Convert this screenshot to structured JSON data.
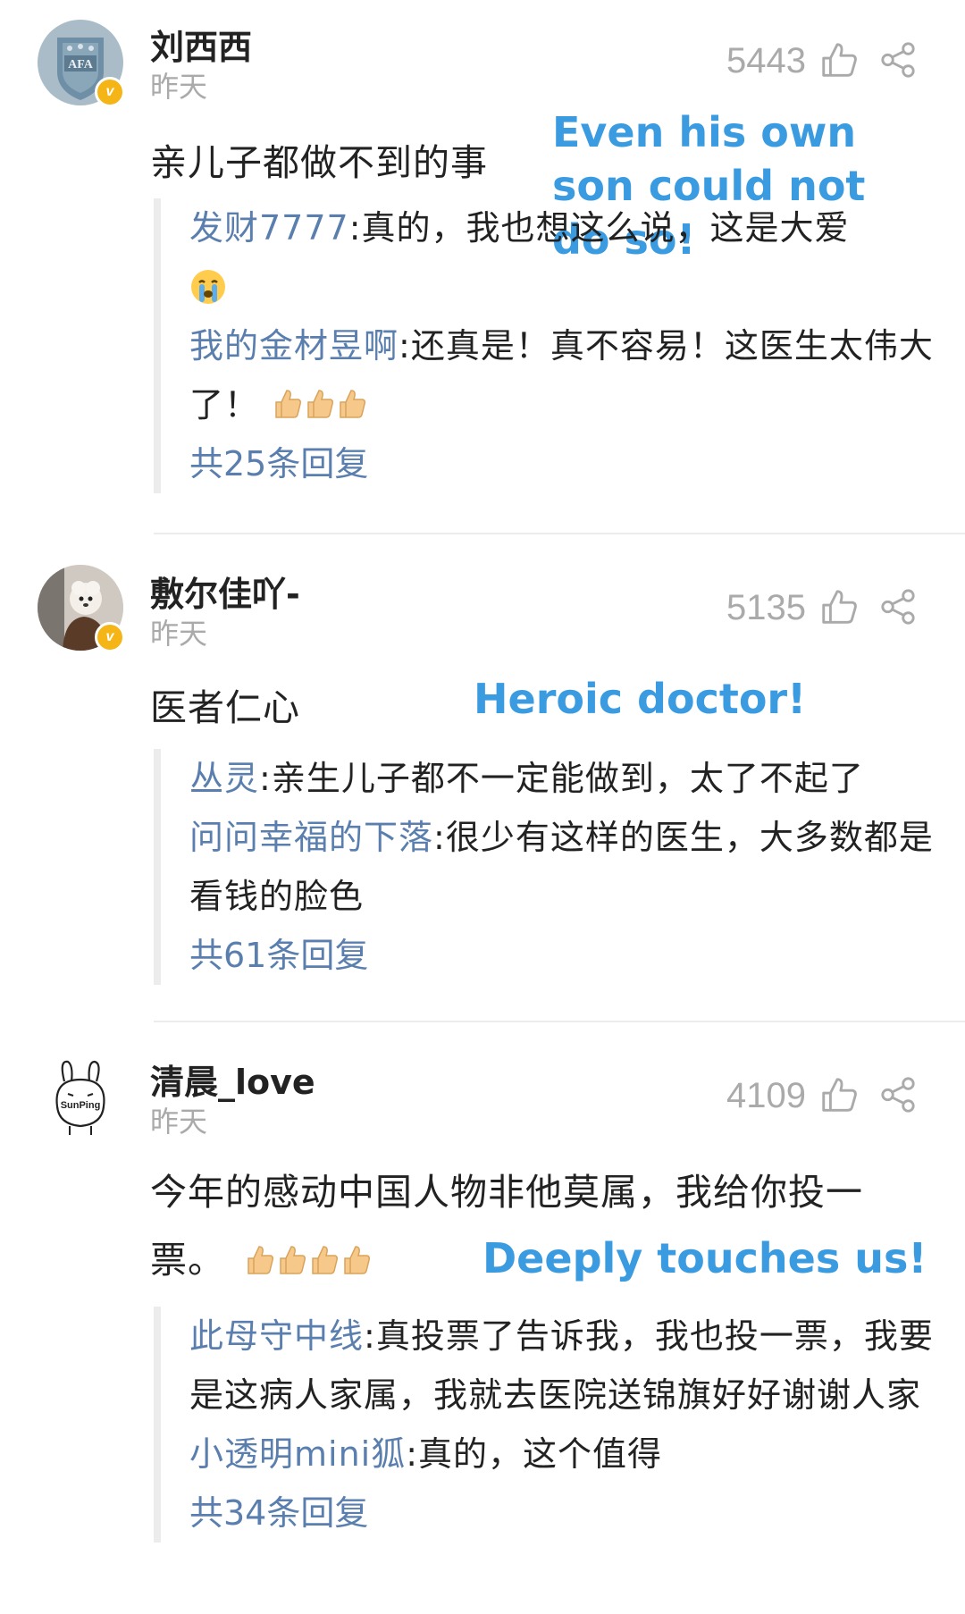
{
  "comments": [
    {
      "username": "刘西西",
      "time": "昨天",
      "likes": "5443",
      "text": "亲儿子都做不到的事",
      "note": "Even his own son could not do so!",
      "replies": [
        {
          "name": "发财7777",
          "sep": ":",
          "text": "真的，我也想这么说，这是大爱",
          "emoji": "crying-face"
        },
        {
          "name": "我的金材昱啊",
          "sep": ":",
          "text": "还真是！真不容易！这医生太伟大了！",
          "emoji": "thumbs-up x3"
        }
      ],
      "more": "共25条回复"
    },
    {
      "username": "敷尔佳吖-",
      "time": "昨天",
      "likes": "5135",
      "text": "医者仁心",
      "note": "Heroic doctor!",
      "replies": [
        {
          "name": "丛灵",
          "sep": ":",
          "text": "亲生儿子都不一定能做到，太了不起了"
        },
        {
          "name": "问问幸福的下落",
          "sep": ":",
          "text": "很少有这样的医生，大多数都是看钱的脸色"
        }
      ],
      "more": "共61条回复"
    },
    {
      "username": "清晨_love",
      "time": "昨天",
      "likes": "4109",
      "text": "今年的感动中国人物非他莫属，我给你投一票。",
      "note": "Deeply touches us!",
      "avatar_text": "SunPing",
      "replies": [
        {
          "name": "此母守中线",
          "sep": ":",
          "text": "真投票了告诉我，我也投一票，我要是这病人家属，我就去医院送锦旗好好谢谢人家"
        },
        {
          "name": "小透明mini狐",
          "sep": ":",
          "text": "真的，这个值得"
        }
      ],
      "more": "共34条回复"
    }
  ],
  "avatar_1_text": "AFA",
  "icons": {
    "like": "thumbs-up-outline-icon",
    "share": "share-icon",
    "verified": "verified-badge-icon"
  },
  "colors": {
    "note": "#3a9be0",
    "reply_name": "#5a7fae",
    "muted": "#aaaaaa",
    "badge": "#f5b516"
  }
}
